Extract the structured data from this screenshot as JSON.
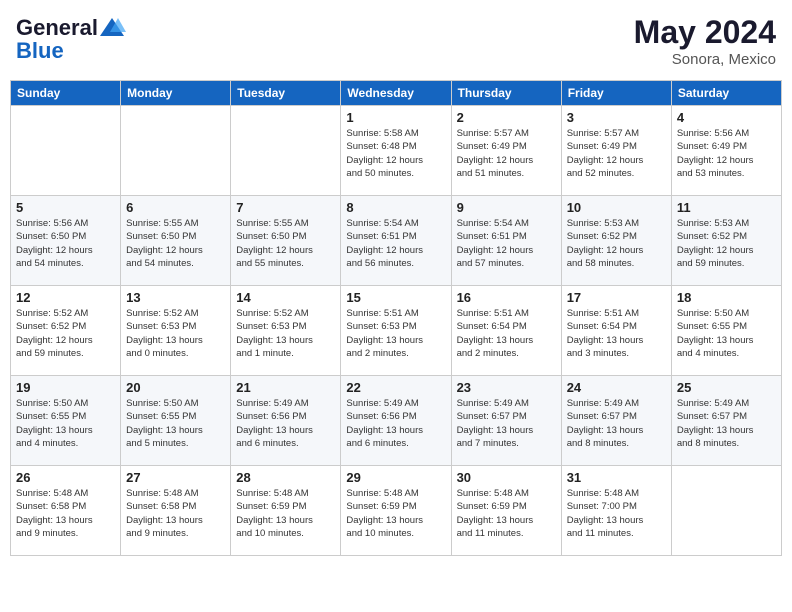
{
  "header": {
    "logo_general": "General",
    "logo_blue": "Blue",
    "month": "May 2024",
    "location": "Sonora, Mexico"
  },
  "days_of_week": [
    "Sunday",
    "Monday",
    "Tuesday",
    "Wednesday",
    "Thursday",
    "Friday",
    "Saturday"
  ],
  "weeks": [
    [
      {
        "day": "",
        "info": ""
      },
      {
        "day": "",
        "info": ""
      },
      {
        "day": "",
        "info": ""
      },
      {
        "day": "1",
        "info": "Sunrise: 5:58 AM\nSunset: 6:48 PM\nDaylight: 12 hours\nand 50 minutes."
      },
      {
        "day": "2",
        "info": "Sunrise: 5:57 AM\nSunset: 6:49 PM\nDaylight: 12 hours\nand 51 minutes."
      },
      {
        "day": "3",
        "info": "Sunrise: 5:57 AM\nSunset: 6:49 PM\nDaylight: 12 hours\nand 52 minutes."
      },
      {
        "day": "4",
        "info": "Sunrise: 5:56 AM\nSunset: 6:49 PM\nDaylight: 12 hours\nand 53 minutes."
      }
    ],
    [
      {
        "day": "5",
        "info": "Sunrise: 5:56 AM\nSunset: 6:50 PM\nDaylight: 12 hours\nand 54 minutes."
      },
      {
        "day": "6",
        "info": "Sunrise: 5:55 AM\nSunset: 6:50 PM\nDaylight: 12 hours\nand 54 minutes."
      },
      {
        "day": "7",
        "info": "Sunrise: 5:55 AM\nSunset: 6:50 PM\nDaylight: 12 hours\nand 55 minutes."
      },
      {
        "day": "8",
        "info": "Sunrise: 5:54 AM\nSunset: 6:51 PM\nDaylight: 12 hours\nand 56 minutes."
      },
      {
        "day": "9",
        "info": "Sunrise: 5:54 AM\nSunset: 6:51 PM\nDaylight: 12 hours\nand 57 minutes."
      },
      {
        "day": "10",
        "info": "Sunrise: 5:53 AM\nSunset: 6:52 PM\nDaylight: 12 hours\nand 58 minutes."
      },
      {
        "day": "11",
        "info": "Sunrise: 5:53 AM\nSunset: 6:52 PM\nDaylight: 12 hours\nand 59 minutes."
      }
    ],
    [
      {
        "day": "12",
        "info": "Sunrise: 5:52 AM\nSunset: 6:52 PM\nDaylight: 12 hours\nand 59 minutes."
      },
      {
        "day": "13",
        "info": "Sunrise: 5:52 AM\nSunset: 6:53 PM\nDaylight: 13 hours\nand 0 minutes."
      },
      {
        "day": "14",
        "info": "Sunrise: 5:52 AM\nSunset: 6:53 PM\nDaylight: 13 hours\nand 1 minute."
      },
      {
        "day": "15",
        "info": "Sunrise: 5:51 AM\nSunset: 6:53 PM\nDaylight: 13 hours\nand 2 minutes."
      },
      {
        "day": "16",
        "info": "Sunrise: 5:51 AM\nSunset: 6:54 PM\nDaylight: 13 hours\nand 2 minutes."
      },
      {
        "day": "17",
        "info": "Sunrise: 5:51 AM\nSunset: 6:54 PM\nDaylight: 13 hours\nand 3 minutes."
      },
      {
        "day": "18",
        "info": "Sunrise: 5:50 AM\nSunset: 6:55 PM\nDaylight: 13 hours\nand 4 minutes."
      }
    ],
    [
      {
        "day": "19",
        "info": "Sunrise: 5:50 AM\nSunset: 6:55 PM\nDaylight: 13 hours\nand 4 minutes."
      },
      {
        "day": "20",
        "info": "Sunrise: 5:50 AM\nSunset: 6:55 PM\nDaylight: 13 hours\nand 5 minutes."
      },
      {
        "day": "21",
        "info": "Sunrise: 5:49 AM\nSunset: 6:56 PM\nDaylight: 13 hours\nand 6 minutes."
      },
      {
        "day": "22",
        "info": "Sunrise: 5:49 AM\nSunset: 6:56 PM\nDaylight: 13 hours\nand 6 minutes."
      },
      {
        "day": "23",
        "info": "Sunrise: 5:49 AM\nSunset: 6:57 PM\nDaylight: 13 hours\nand 7 minutes."
      },
      {
        "day": "24",
        "info": "Sunrise: 5:49 AM\nSunset: 6:57 PM\nDaylight: 13 hours\nand 8 minutes."
      },
      {
        "day": "25",
        "info": "Sunrise: 5:49 AM\nSunset: 6:57 PM\nDaylight: 13 hours\nand 8 minutes."
      }
    ],
    [
      {
        "day": "26",
        "info": "Sunrise: 5:48 AM\nSunset: 6:58 PM\nDaylight: 13 hours\nand 9 minutes."
      },
      {
        "day": "27",
        "info": "Sunrise: 5:48 AM\nSunset: 6:58 PM\nDaylight: 13 hours\nand 9 minutes."
      },
      {
        "day": "28",
        "info": "Sunrise: 5:48 AM\nSunset: 6:59 PM\nDaylight: 13 hours\nand 10 minutes."
      },
      {
        "day": "29",
        "info": "Sunrise: 5:48 AM\nSunset: 6:59 PM\nDaylight: 13 hours\nand 10 minutes."
      },
      {
        "day": "30",
        "info": "Sunrise: 5:48 AM\nSunset: 6:59 PM\nDaylight: 13 hours\nand 11 minutes."
      },
      {
        "day": "31",
        "info": "Sunrise: 5:48 AM\nSunset: 7:00 PM\nDaylight: 13 hours\nand 11 minutes."
      },
      {
        "day": "",
        "info": ""
      }
    ]
  ]
}
